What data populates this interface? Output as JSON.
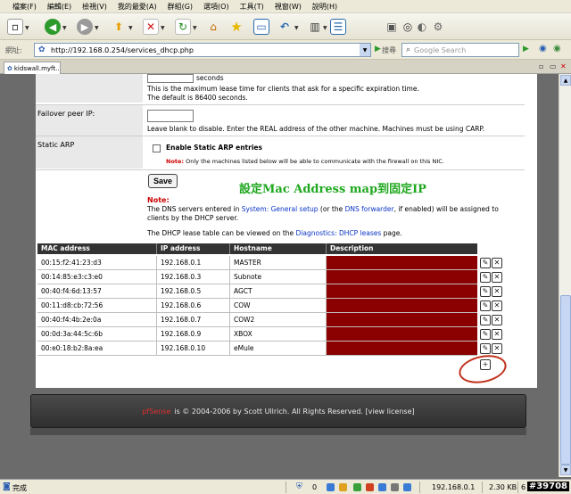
{
  "menu": [
    "檔案(F)",
    "編輯(E)",
    "檢視(V)",
    "我的最愛(A)",
    "群組(G)",
    "選項(O)",
    "工具(T)",
    "視窗(W)",
    "說明(H)"
  ],
  "address": {
    "label": "網址:",
    "url": "http://192.168.0.254/services_dhcp.php"
  },
  "search": {
    "label": "搜尋",
    "placeholder": "Google Search"
  },
  "tab": {
    "title": "kidswall.myft..."
  },
  "form": {
    "lease_unit": "seconds",
    "lease_desc1": "This is the maximum lease time for clients that ask for a specific expiration time.",
    "lease_desc2": "The default is 86400 seconds.",
    "failover_label": "Failover peer IP:",
    "failover_desc": "Leave blank to disable. Enter the REAL address of the other machine. Machines must be using CARP.",
    "static_arp_label": "Static ARP",
    "static_arp_check": "Enable Static ARP entries",
    "static_arp_note_label": "Note:",
    "static_arp_note": "Only the machines listed below will be able to communicate with the firewall on this NIC.",
    "save_label": "Save",
    "annotation": "設定Mac Address map到固定IP",
    "note_label": "Note:",
    "note_p1": "The DNS servers entered in",
    "note_link1": "System: General setup",
    "note_p2": "(or the",
    "note_link2": "DNS forwarder",
    "note_p3": ", if enabled) will be assigned to clients by the DHCP server.",
    "lease_view_p1": "The DHCP lease table can be viewed on the",
    "lease_view_link": "Diagnostics: DHCP leases",
    "lease_view_p2": "page."
  },
  "table": {
    "headers": [
      "MAC address",
      "IP address",
      "Hostname",
      "Description"
    ],
    "rows": [
      [
        "00:15:f2:41:23:d3",
        "192.168.0.1",
        "MASTER",
        ""
      ],
      [
        "00:14:85:e3:c3:e0",
        "192.168.0.3",
        "Subnote",
        ""
      ],
      [
        "00:40:f4:6d:13:57",
        "192.168.0.5",
        "AGCT",
        ""
      ],
      [
        "00:11:d8:cb:72:56",
        "192.168.0.6",
        "COW",
        ""
      ],
      [
        "00:40:f4:4b:2e:0a",
        "192.168.0.7",
        "COW2",
        ""
      ],
      [
        "00:0d:3a:44:5c:6b",
        "192.168.0.9",
        "XBOX",
        ""
      ],
      [
        "00:e0:18:b2:8a:ea",
        "192.168.0.10",
        "eMule",
        ""
      ]
    ],
    "description_color": "#8b0000"
  },
  "footer": {
    "brand": "pfSense",
    "text": "is © 2004-2006 by Scott Ullrich. All Rights Reserved. [view license]"
  },
  "status": {
    "done": "完成",
    "count": "0",
    "ip": "192.168.0.1",
    "size": "2.30 KB",
    "page": "6",
    "watermark": "#39708"
  }
}
